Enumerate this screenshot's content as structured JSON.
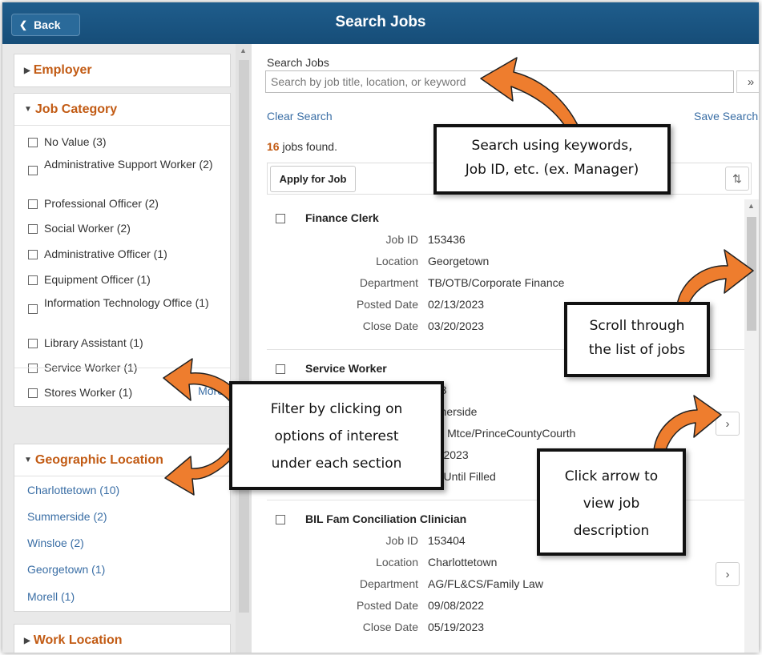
{
  "header": {
    "back_label": "Back",
    "title": "Search Jobs"
  },
  "left_panel": {
    "employer": {
      "label": "Employer",
      "expanded": false
    },
    "job_category": {
      "label": "Job Category",
      "expanded": true,
      "items": [
        "No Value (3)",
        "Administrative Support Worker (2)",
        "Professional Officer (2)",
        "Social Worker (2)",
        "Administrative Officer (1)",
        "Equipment Officer (1)",
        "Information Technology Office (1)",
        "Library Assistant (1)",
        "Service Worker (1)",
        "Stores Worker (1)"
      ],
      "more_label": "More"
    },
    "geographic_location": {
      "label": "Geographic Location",
      "expanded": true,
      "items": [
        "Charlottetown (10)",
        "Summerside (2)",
        "Winsloe (2)",
        "Georgetown (1)",
        "Morell (1)"
      ]
    },
    "work_location": {
      "label": "Work Location",
      "expanded": false
    }
  },
  "search": {
    "label": "Search Jobs",
    "placeholder": "Search by job title, location, or keyword",
    "go_icon": "double-chevron-right-icon",
    "clear_label": "Clear Search",
    "save_label": "Save Search"
  },
  "results": {
    "count": "16",
    "count_suffix": " jobs found.",
    "apply_label": "Apply for Job",
    "sort_icon": "sort-icon",
    "field_labels": {
      "job_id": "Job ID",
      "location": "Location",
      "department": "Department",
      "posted": "Posted Date",
      "close": "Close Date"
    },
    "jobs": [
      {
        "title": "Finance Clerk",
        "job_id": "153436",
        "location": "Georgetown",
        "department": "TB/OTB/Corporate Finance",
        "posted": "02/13/2023",
        "close": "03/20/2023"
      },
      {
        "title": "Service Worker",
        "job_id": "433",
        "location": "mmerside",
        "department": "Bld Mtce/PrinceCountyCourth",
        "posted": "09/2023",
        "close": "en Until Filled"
      },
      {
        "title": "BIL Fam Conciliation Clinician",
        "job_id": "153404",
        "location": "Charlottetown",
        "department": "AG/FL&CS/Family Law",
        "posted": "09/08/2022",
        "close": "05/19/2023"
      }
    ]
  },
  "callouts": {
    "search": [
      "Search using keywords,",
      "Job ID, etc. (ex. Manager)"
    ],
    "scroll": [
      "Scroll through",
      "the list of jobs"
    ],
    "filter": [
      "Filter by clicking on",
      "options of interest",
      "under each section"
    ],
    "arrow": [
      "Click arrow to",
      "view job",
      "description"
    ]
  },
  "colors": {
    "header_bg": "#1a5685",
    "accent_orange": "#c25b14",
    "link_blue": "#3a6ea5",
    "arrow_orange": "#ee7d2e"
  }
}
